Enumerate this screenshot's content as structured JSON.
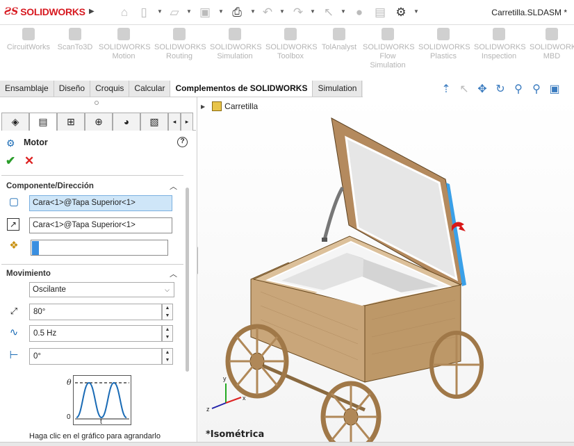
{
  "app": {
    "brand": "SOLIDWORKS",
    "document_title": "Carretilla.SLDASM *",
    "toolbar_icons": [
      "home-icon",
      "new-icon",
      "open-icon",
      "save-icon",
      "print-icon",
      "undo-icon",
      "redo-icon",
      "select-icon",
      "rebuild-icon",
      "file-properties-icon",
      "options-gear-icon"
    ]
  },
  "ribbon": {
    "addins": [
      {
        "label": "CircuitWorks",
        "sub": ""
      },
      {
        "label": "ScanTo3D",
        "sub": ""
      },
      {
        "label": "SOLIDWORKS",
        "sub": "Motion"
      },
      {
        "label": "SOLIDWORKS",
        "sub": "Routing"
      },
      {
        "label": "SOLIDWORKS",
        "sub": "Simulation"
      },
      {
        "label": "SOLIDWORKS",
        "sub": "Toolbox"
      },
      {
        "label": "TolAnalyst",
        "sub": ""
      },
      {
        "label": "SOLIDWORKS",
        "sub": "Flow",
        "sub2": "Simulation"
      },
      {
        "label": "SOLIDWORKS",
        "sub": "Plastics"
      },
      {
        "label": "SOLIDWORKS",
        "sub": "Inspection"
      },
      {
        "label": "SOLIDWORKS",
        "sub": "MBD"
      }
    ]
  },
  "tabs": [
    "Ensamblaje",
    "Diseño",
    "Croquis",
    "Calcular",
    "Complementos de SOLIDWORKS",
    "Simulation"
  ],
  "active_tab": "Complementos de SOLIDWORKS",
  "panel": {
    "title": "Motor",
    "ok_symbol": "✔",
    "cancel_symbol": "✕",
    "section1": {
      "title": "Componente/Dirección",
      "field1": "Cara<1>@Tapa Superior<1>",
      "field2": "Cara<1>@Tapa Superior<1>",
      "field3": ""
    },
    "section2": {
      "title": "Movimiento",
      "type": "Oscilante",
      "amplitude": "80°",
      "frequency": "0.5 Hz",
      "phase": "0°"
    },
    "graph": {
      "y_label": "θ",
      "y_zero": "0",
      "x_label": "t",
      "hint": "Haga clic en el gráfico para agrandarlo"
    }
  },
  "viewport": {
    "tree_root": "Carretilla",
    "view_name": "*Isométrica",
    "triad": {
      "x": "x",
      "y": "y",
      "z": "z"
    },
    "colors": {
      "wood": "#c9a67a",
      "wood_dark": "#a88256",
      "panel_gray": "#e8e8e8",
      "selected_face": "#3aa0e8",
      "motor_arrow": "#d81818"
    }
  }
}
